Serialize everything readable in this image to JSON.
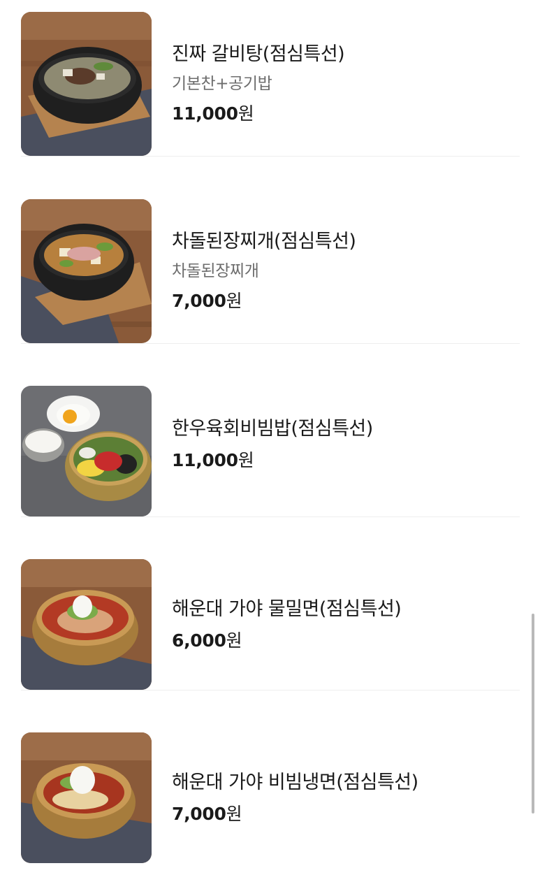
{
  "menu": {
    "items": [
      {
        "name": "진짜 갈비탕(점심특선)",
        "description": "기본찬+공기밥",
        "price": "11,000",
        "currency": "원",
        "image": "galbitang-photo"
      },
      {
        "name": "차돌된장찌개(점심특선)",
        "description": "차돌된장찌개",
        "price": "7,000",
        "currency": "원",
        "image": "doenjang-jjigae-photo"
      },
      {
        "name": "한우육회비빔밥(점심특선)",
        "price": "11,000",
        "currency": "원",
        "image": "yukhoe-bibimbap-photo"
      },
      {
        "name": "해운대 가야 물밀면(점심특선)",
        "price": "6,000",
        "currency": "원",
        "image": "mul-milmyeon-photo"
      },
      {
        "name": "해운대 가야 비빔냉면(점심특선)",
        "price": "7,000",
        "currency": "원",
        "image": "bibim-naengmyeon-photo"
      }
    ]
  },
  "colors": {
    "text_primary": "#1a1a1a",
    "text_secondary": "#6d6d6d",
    "divider": "#eeeeee",
    "scrollbar": "#b9b9b9"
  }
}
